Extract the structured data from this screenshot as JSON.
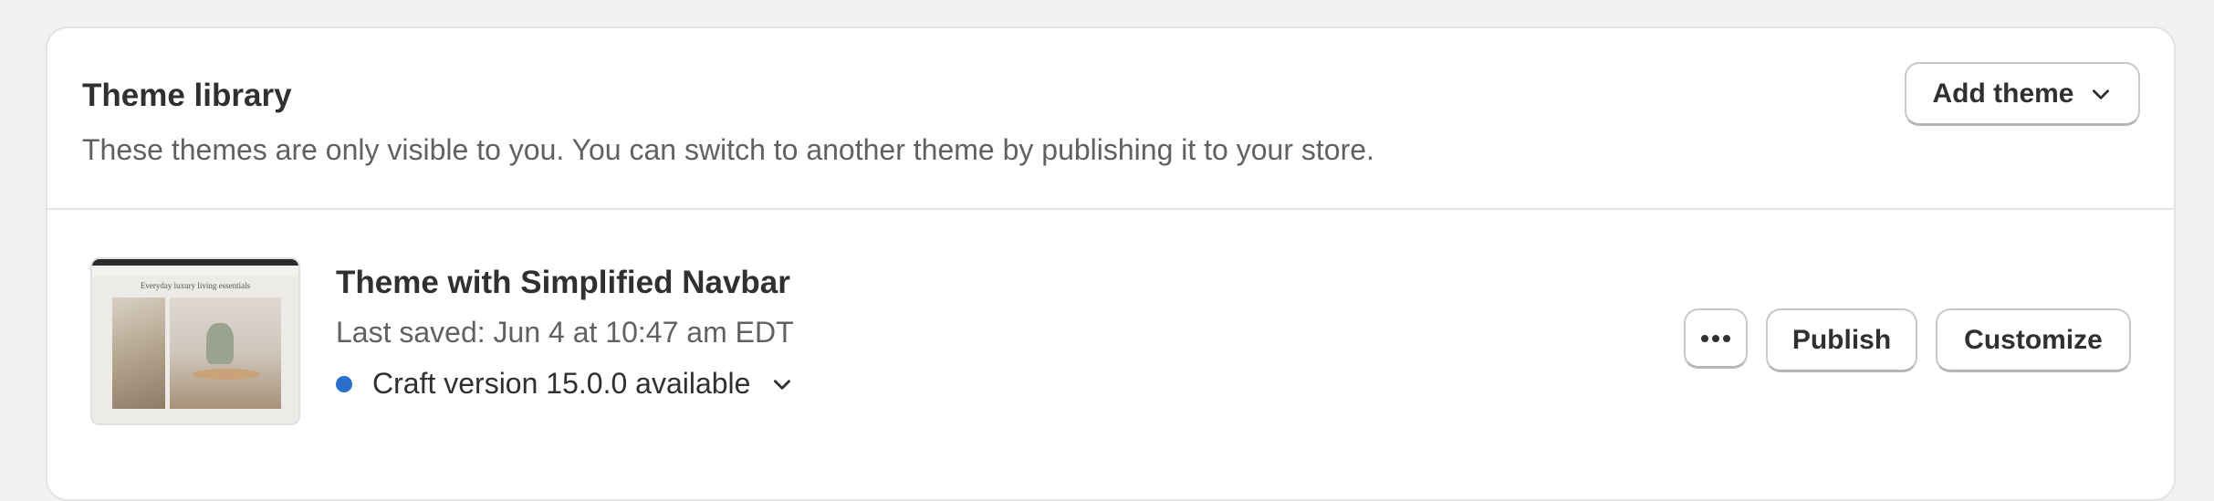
{
  "library": {
    "title": "Theme library",
    "subtitle": "These themes are only visible to you. You can switch to another theme by publishing it to your store.",
    "add_theme_label": "Add theme"
  },
  "theme": {
    "name": "Theme with Simplified Navbar",
    "last_saved": "Last saved: Jun 4 at 10:47 am EDT",
    "version_text": "Craft version 15.0.0 available",
    "status_color": "#2c6ecb",
    "thumbnail": {
      "heading": "Everyday luxury living essentials"
    },
    "actions": {
      "more_icon": "ellipsis-icon",
      "publish_label": "Publish",
      "customize_label": "Customize"
    }
  }
}
